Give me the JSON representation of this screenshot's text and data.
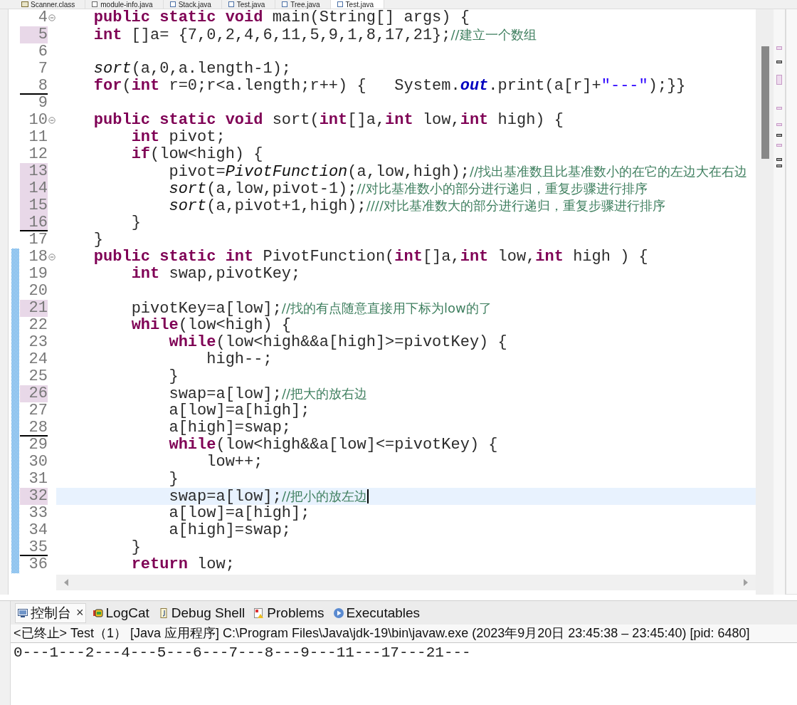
{
  "editor_tabs": [
    {
      "label": "Scanner.class",
      "kind": "class",
      "selected": false
    },
    {
      "label": "module-info.java",
      "kind": "module",
      "selected": false
    },
    {
      "label": "Stack.java",
      "kind": "java",
      "selected": false
    },
    {
      "label": "Test.java",
      "kind": "java",
      "selected": false
    },
    {
      "label": "Tree.java",
      "kind": "java",
      "selected": false
    },
    {
      "label": "Test.java",
      "kind": "java",
      "selected": true
    }
  ],
  "lines": [
    {
      "number": "4",
      "fold": true,
      "occurrence": false,
      "changed": false,
      "separator_below": false,
      "current": false,
      "tokens": [
        {
          "kind": "kw",
          "text": "\tpublic static void"
        },
        {
          "kind": "txt",
          "text": " main(String[] args) {"
        }
      ]
    },
    {
      "number": "5",
      "fold": false,
      "occurrence": true,
      "changed": false,
      "separator_below": false,
      "current": false,
      "tokens": [
        {
          "kind": "kw",
          "text": "\tint"
        },
        {
          "kind": "txt",
          "text": " []a= {7,0,2,4,6,11,5,9,1,8,17,21};"
        },
        {
          "kind": "cmt",
          "text": "//建立一个数组"
        }
      ]
    },
    {
      "number": "6",
      "fold": false,
      "occurrence": false,
      "changed": false,
      "separator_below": false,
      "current": false
    },
    {
      "number": "7",
      "fold": false,
      "occurrence": false,
      "changed": false,
      "separator_below": false,
      "current": false,
      "tokens": [
        {
          "kind": "ital",
          "text": "\tsort"
        },
        {
          "kind": "txt",
          "text": "(a,0,a.length-1);"
        }
      ]
    },
    {
      "number": "8",
      "fold": false,
      "occurrence": false,
      "changed": false,
      "separator_below": true,
      "current": false,
      "tokens": [
        {
          "kind": "kw",
          "text": "\tfor"
        },
        {
          "kind": "txt",
          "text": "("
        },
        {
          "kind": "kw",
          "text": "int"
        },
        {
          "kind": "txt",
          "text": " r=0;r<a.length;r++) {   System."
        },
        {
          "kind": "field",
          "text": "out"
        },
        {
          "kind": "txt",
          "text": ".print(a[r]+"
        },
        {
          "kind": "str",
          "text": "\"---\""
        },
        {
          "kind": "txt",
          "text": ");}}"
        }
      ]
    },
    {
      "number": "9",
      "fold": false,
      "occurrence": false,
      "changed": false,
      "separator_below": false,
      "current": false
    },
    {
      "number": "10",
      "fold": true,
      "occurrence": false,
      "changed": false,
      "separator_below": false,
      "current": false,
      "tokens": [
        {
          "kind": "kw",
          "text": "\tpublic static void"
        },
        {
          "kind": "txt",
          "text": " sort("
        },
        {
          "kind": "kw",
          "text": "int"
        },
        {
          "kind": "txt",
          "text": "[]a,"
        },
        {
          "kind": "kw",
          "text": "int"
        },
        {
          "kind": "txt",
          "text": " low,"
        },
        {
          "kind": "kw",
          "text": "int"
        },
        {
          "kind": "txt",
          "text": " high) {"
        }
      ]
    },
    {
      "number": "11",
      "fold": false,
      "occurrence": false,
      "changed": false,
      "separator_below": false,
      "current": false,
      "tokens": [
        {
          "kind": "kw",
          "text": "\t\tint"
        },
        {
          "kind": "txt",
          "text": " pivot;"
        }
      ]
    },
    {
      "number": "12",
      "fold": false,
      "occurrence": false,
      "changed": false,
      "separator_below": false,
      "current": false,
      "tokens": [
        {
          "kind": "kw",
          "text": "\t\tif"
        },
        {
          "kind": "txt",
          "text": "(low<high) {"
        }
      ]
    },
    {
      "number": "13",
      "fold": false,
      "occurrence": true,
      "changed": false,
      "separator_below": false,
      "current": false,
      "tokens": [
        {
          "kind": "txt",
          "text": "\t\t\tpivot="
        },
        {
          "kind": "ital",
          "text": "PivotFunction"
        },
        {
          "kind": "txt",
          "text": "(a,low,high);"
        },
        {
          "kind": "cmt",
          "text": "//找出基准数且比基准数小的在它的左边大在右边"
        }
      ]
    },
    {
      "number": "14",
      "fold": false,
      "occurrence": true,
      "changed": false,
      "separator_below": false,
      "current": false,
      "tokens": [
        {
          "kind": "ital",
          "text": "\t\t\tsort"
        },
        {
          "kind": "txt",
          "text": "(a,low,pivot-1);"
        },
        {
          "kind": "cmt",
          "text": "//对比基准数小的部分进行递归，重复步骤进行排序"
        }
      ]
    },
    {
      "number": "15",
      "fold": false,
      "occurrence": true,
      "changed": false,
      "separator_below": false,
      "current": false,
      "tokens": [
        {
          "kind": "ital",
          "text": "\t\t\tsort"
        },
        {
          "kind": "txt",
          "text": "(a,pivot+1,high);"
        },
        {
          "kind": "cmt",
          "text": "////对比基准数大的部分进行递归，重复步骤进行排序"
        }
      ]
    },
    {
      "number": "16",
      "fold": false,
      "occurrence": true,
      "changed": false,
      "separator_below": true,
      "current": false,
      "tokens": [
        {
          "kind": "txt",
          "text": "\t\t}"
        }
      ]
    },
    {
      "number": "17",
      "fold": false,
      "occurrence": false,
      "changed": false,
      "separator_below": false,
      "current": false,
      "tokens": [
        {
          "kind": "txt",
          "text": "\t}"
        }
      ]
    },
    {
      "number": "18",
      "fold": true,
      "occurrence": false,
      "changed": true,
      "separator_below": false,
      "current": false,
      "tokens": [
        {
          "kind": "kw",
          "text": "\tpublic static int"
        },
        {
          "kind": "txt",
          "text": " PivotFunction("
        },
        {
          "kind": "kw",
          "text": "int"
        },
        {
          "kind": "txt",
          "text": "[]a,"
        },
        {
          "kind": "kw",
          "text": "int"
        },
        {
          "kind": "txt",
          "text": " low,"
        },
        {
          "kind": "kw",
          "text": "int"
        },
        {
          "kind": "txt",
          "text": " high ) {"
        }
      ]
    },
    {
      "number": "19",
      "fold": false,
      "occurrence": false,
      "changed": true,
      "separator_below": false,
      "current": false,
      "tokens": [
        {
          "kind": "kw",
          "text": "\t\tint"
        },
        {
          "kind": "txt",
          "text": " swap,pivotKey;"
        }
      ]
    },
    {
      "number": "20",
      "fold": false,
      "occurrence": false,
      "changed": true,
      "separator_below": false,
      "current": false
    },
    {
      "number": "21",
      "fold": false,
      "occurrence": true,
      "changed": true,
      "separator_below": false,
      "current": false,
      "tokens": [
        {
          "kind": "txt",
          "text": "\t\tpivotKey=a[low];"
        },
        {
          "kind": "cmt",
          "text": "//找的有点随意直接用下标为low的了"
        }
      ]
    },
    {
      "number": "22",
      "fold": false,
      "occurrence": false,
      "changed": true,
      "separator_below": false,
      "current": false,
      "tokens": [
        {
          "kind": "kw",
          "text": "\t\twhile"
        },
        {
          "kind": "txt",
          "text": "(low<high) {"
        }
      ]
    },
    {
      "number": "23",
      "fold": false,
      "occurrence": false,
      "changed": true,
      "separator_below": false,
      "current": false,
      "tokens": [
        {
          "kind": "kw",
          "text": "\t\t\twhile"
        },
        {
          "kind": "txt",
          "text": "(low<high&&a[high]>=pivotKey) {"
        }
      ]
    },
    {
      "number": "24",
      "fold": false,
      "occurrence": false,
      "changed": true,
      "separator_below": false,
      "current": false,
      "tokens": [
        {
          "kind": "txt",
          "text": "\t\t\t\thigh--;"
        }
      ]
    },
    {
      "number": "25",
      "fold": false,
      "occurrence": false,
      "changed": true,
      "separator_below": false,
      "current": false,
      "tokens": [
        {
          "kind": "txt",
          "text": "\t\t\t}"
        }
      ]
    },
    {
      "number": "26",
      "fold": false,
      "occurrence": true,
      "changed": true,
      "separator_below": false,
      "current": false,
      "tokens": [
        {
          "kind": "txt",
          "text": "\t\t\tswap=a[low];"
        },
        {
          "kind": "cmt",
          "text": "//把大的放右边"
        }
      ]
    },
    {
      "number": "27",
      "fold": false,
      "occurrence": false,
      "changed": true,
      "separator_below": false,
      "current": false,
      "tokens": [
        {
          "kind": "txt",
          "text": "\t\t\ta[low]=a[high];"
        }
      ]
    },
    {
      "number": "28",
      "fold": false,
      "occurrence": false,
      "changed": true,
      "separator_below": true,
      "current": false,
      "tokens": [
        {
          "kind": "txt",
          "text": "\t\t\ta[high]=swap;"
        }
      ]
    },
    {
      "number": "29",
      "fold": false,
      "occurrence": false,
      "changed": true,
      "separator_below": false,
      "current": false,
      "tokens": [
        {
          "kind": "kw",
          "text": "\t\t\twhile"
        },
        {
          "kind": "txt",
          "text": "(low<high&&a[low]<=pivotKey) {"
        }
      ]
    },
    {
      "number": "30",
      "fold": false,
      "occurrence": false,
      "changed": true,
      "separator_below": false,
      "current": false,
      "tokens": [
        {
          "kind": "txt",
          "text": "\t\t\t\tlow++;"
        }
      ]
    },
    {
      "number": "31",
      "fold": false,
      "occurrence": false,
      "changed": true,
      "separator_below": false,
      "current": false,
      "tokens": [
        {
          "kind": "txt",
          "text": "\t\t\t}"
        }
      ]
    },
    {
      "number": "32",
      "fold": false,
      "occurrence": true,
      "changed": true,
      "separator_below": false,
      "current": true,
      "tokens": [
        {
          "kind": "txt",
          "text": "\t\t\tswap=a[low];"
        },
        {
          "kind": "cmt",
          "text": "//把小的放左边"
        }
      ]
    },
    {
      "number": "33",
      "fold": false,
      "occurrence": false,
      "changed": true,
      "separator_below": false,
      "current": false,
      "tokens": [
        {
          "kind": "txt",
          "text": "\t\t\ta[low]=a[high];"
        }
      ]
    },
    {
      "number": "34",
      "fold": false,
      "occurrence": false,
      "changed": true,
      "separator_below": false,
      "current": false,
      "tokens": [
        {
          "kind": "txt",
          "text": "\t\t\ta[high]=swap;"
        }
      ]
    },
    {
      "number": "35",
      "fold": false,
      "occurrence": false,
      "changed": true,
      "separator_below": true,
      "current": false,
      "tokens": [
        {
          "kind": "txt",
          "text": "\t\t}"
        }
      ]
    },
    {
      "number": "36",
      "fold": false,
      "occurrence": false,
      "changed": true,
      "separator_below": false,
      "current": false,
      "tokens": [
        {
          "kind": "kw",
          "text": "\t\treturn"
        },
        {
          "kind": "txt",
          "text": " low;"
        }
      ]
    }
  ],
  "panel_tabs": [
    {
      "label": "控制台",
      "kind": "console",
      "selected": true,
      "close": "×"
    },
    {
      "label": "LogCat",
      "kind": "logcat",
      "selected": false
    },
    {
      "label": "Debug Shell",
      "kind": "shell",
      "selected": false
    },
    {
      "label": "Problems",
      "kind": "problems",
      "selected": false
    },
    {
      "label": "Executables",
      "kind": "executables",
      "selected": false
    }
  ],
  "console": {
    "status": "<已终止> Test（1）  [Java 应用程序] C:\\Program Files\\Java\\jdk-19\\bin\\javaw.exe  (2023年9月20日 23:45:38 – 23:45:40) [pid: 6480]",
    "output": "0---1---2---4---5---6---7---8---9---11---17---21---"
  }
}
